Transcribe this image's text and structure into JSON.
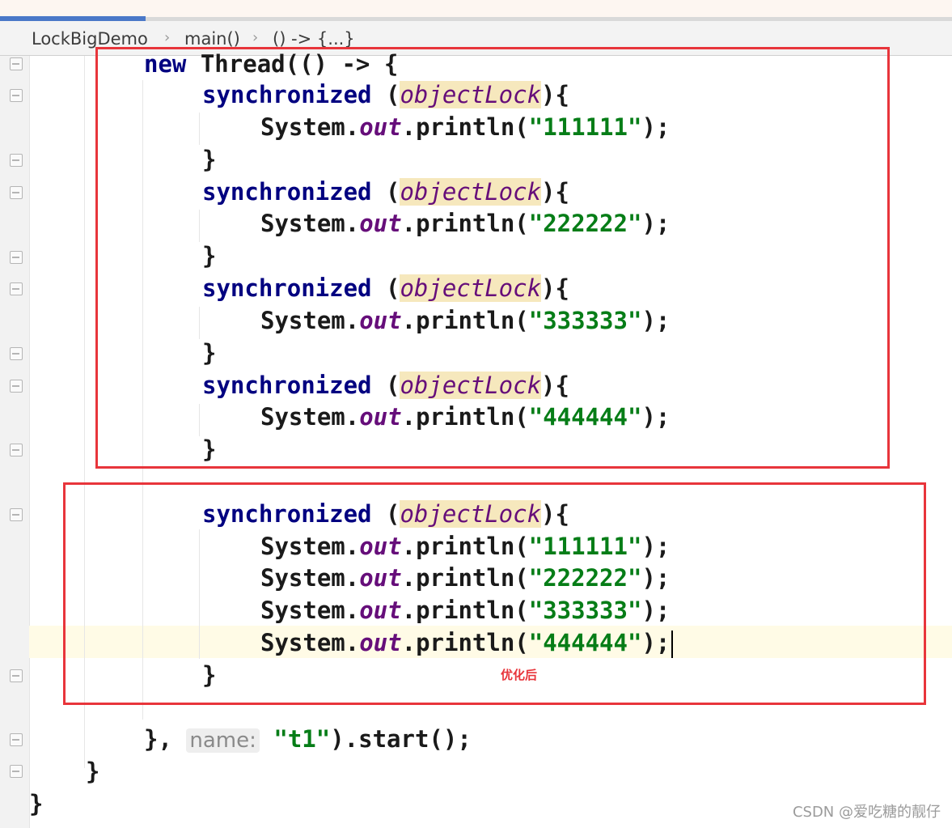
{
  "breadcrumb": {
    "items": [
      "LockBigDemo",
      "main()",
      "() -> {...}"
    ],
    "separator": "›"
  },
  "code": {
    "line_new_thread": {
      "keyword": "new",
      "rest": " Thread(() -> {"
    },
    "sync_keyword": "synchronized",
    "lock_name": "objectLock",
    "sync_open": " (",
    "sync_close": "){",
    "close_brace": "}",
    "println_prefix": "System.",
    "println_field": "out",
    "println_method": ".println(",
    "println_suffix": ");",
    "strings": [
      "\"111111\"",
      "\"222222\"",
      "\"333333\"",
      "\"444444\""
    ],
    "thread_end": {
      "before": "}, ",
      "hint": "name:",
      "value": "\"t1\"",
      "after": ").start();"
    },
    "close_inner": "}",
    "close_outer": "}"
  },
  "annotation": "优化后",
  "watermark": "CSDN @爱吃糖的靓仔",
  "colors": {
    "keyword": "#000080",
    "field": "#660e7a",
    "string": "#067d17",
    "lock_highlight": "#f6e8bd",
    "box_border": "#e8353b",
    "current_line": "#fffbe6"
  }
}
